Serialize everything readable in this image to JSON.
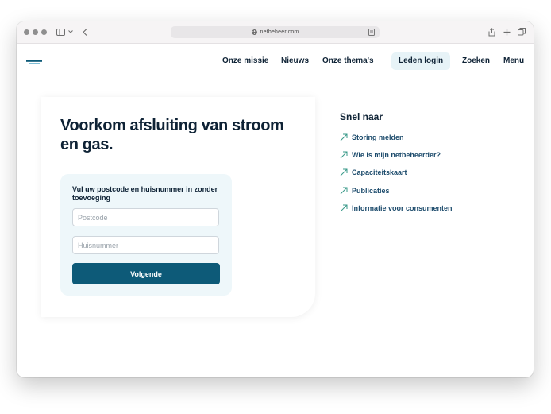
{
  "browser": {
    "url": "netbeheer.com"
  },
  "nav": {
    "items": [
      "Onze missie",
      "Nieuws",
      "Onze thema's"
    ],
    "login": "Leden login",
    "search": "Zoeken",
    "menu": "Menu"
  },
  "hero": {
    "title": "Voorkom afsluiting van stroom en gas."
  },
  "form": {
    "label": "Vul uw postcode en huisnummer in zonder toevoeging",
    "postcode_placeholder": "Postcode",
    "postcode_value": "",
    "housenumber_placeholder": "Huisnummer",
    "housenumber_value": "",
    "submit_label": "Volgende"
  },
  "quick": {
    "title": "Snel naar",
    "links": [
      "Storing melden",
      "Wie is mijn netbeheerder?",
      "Capaciteitskaart",
      "Publicaties",
      "Informatie voor consumenten"
    ]
  },
  "colors": {
    "primary": "#0d5a78",
    "heading": "#0e2235",
    "link": "#1b4a6b",
    "accent": "#3a9a8a"
  }
}
